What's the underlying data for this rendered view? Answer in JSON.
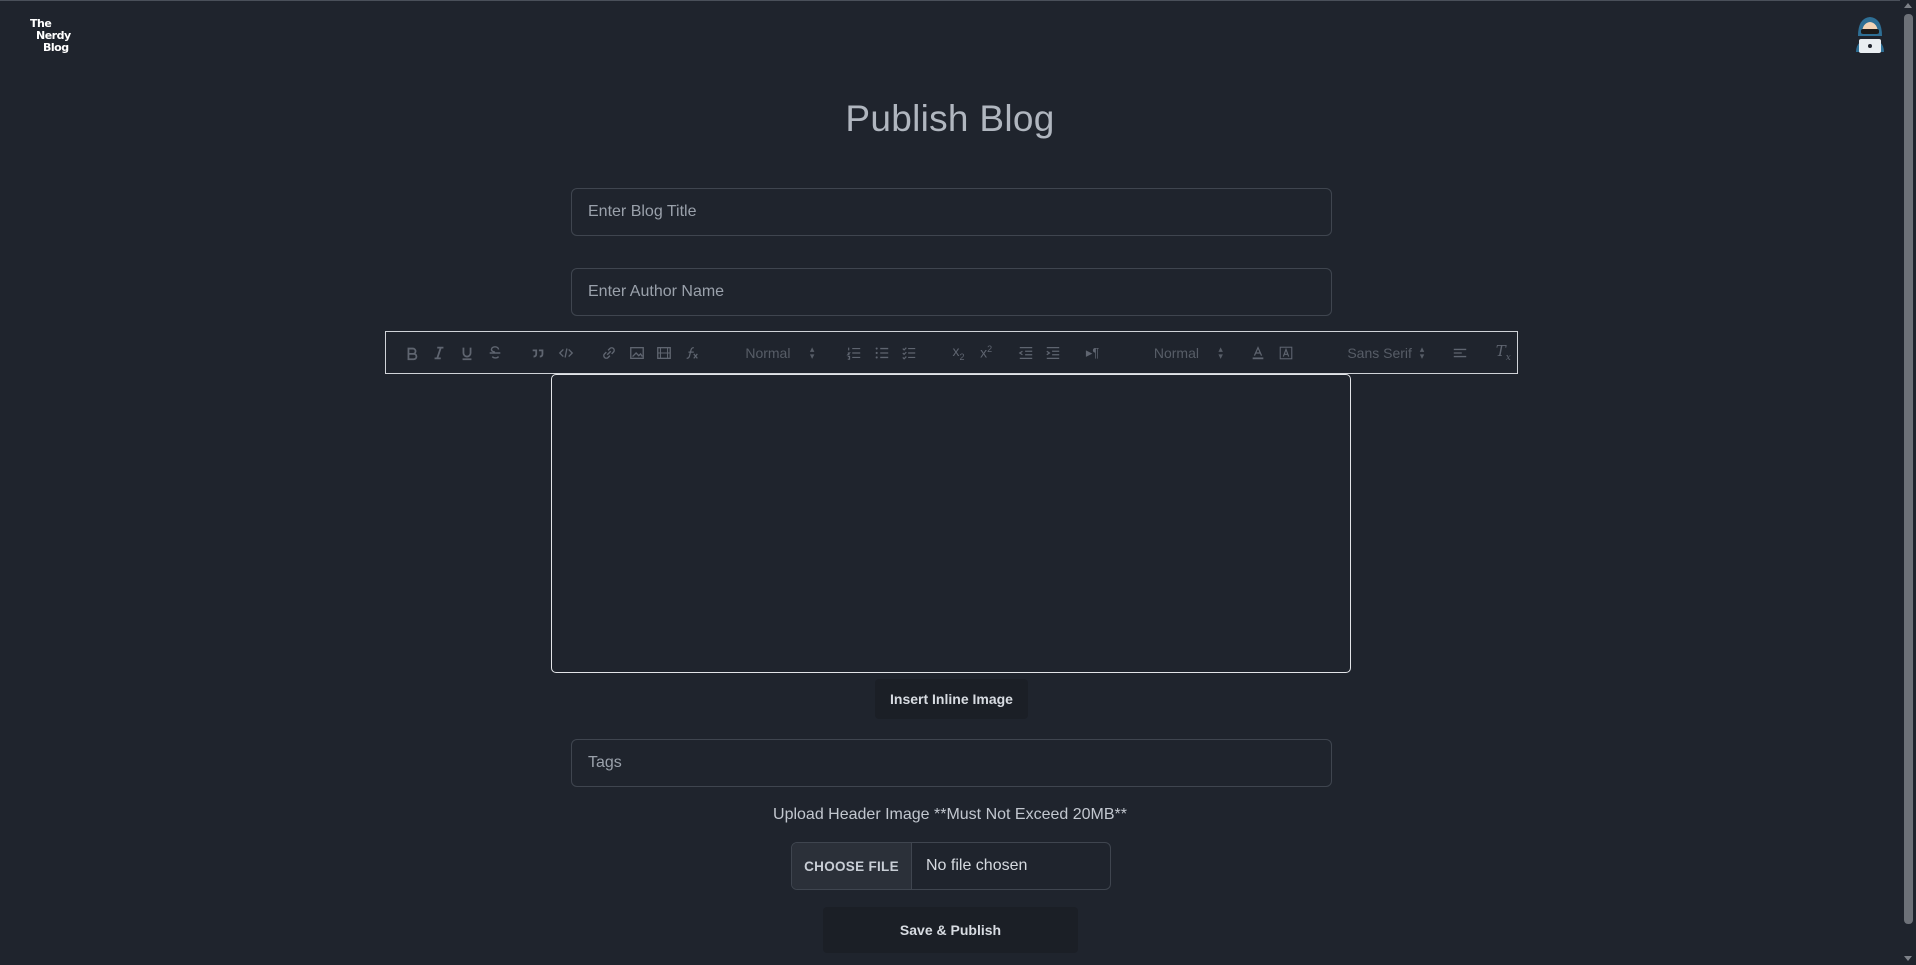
{
  "brand": {
    "logo_lines": [
      "The",
      "Nerdy",
      "Blog"
    ]
  },
  "header": {
    "avatar_icon": "hacker-avatar-icon"
  },
  "page": {
    "title": "Publish Blog"
  },
  "form": {
    "title_placeholder": "Enter Blog Title",
    "author_placeholder": "Enter Author Name",
    "tags_placeholder": "Tags",
    "insert_image_label": "Insert Inline Image",
    "upload_label": "Upload Header Image **Must Not Exceed 20MB**",
    "choose_file_label": "CHOOSE FILE",
    "file_status": "No file chosen",
    "publish_label": "Save & Publish"
  },
  "toolbar": {
    "header_picker": "Normal",
    "size_picker": "Normal",
    "font_picker": "Sans Serif",
    "icons": [
      "bold-icon",
      "italic-icon",
      "underline-icon",
      "strike-icon",
      "blockquote-icon",
      "code-block-icon",
      "link-icon",
      "image-icon",
      "video-icon",
      "formula-icon",
      "ordered-list-icon",
      "bullet-list-icon",
      "check-list-icon",
      "subscript-icon",
      "superscript-icon",
      "outdent-icon",
      "indent-icon",
      "rtl-icon",
      "text-color-icon",
      "background-color-icon",
      "align-icon",
      "clean-format-icon"
    ]
  },
  "colors": {
    "background": "#1f242d",
    "border": "#3f454f",
    "button": "#1b1f26"
  }
}
